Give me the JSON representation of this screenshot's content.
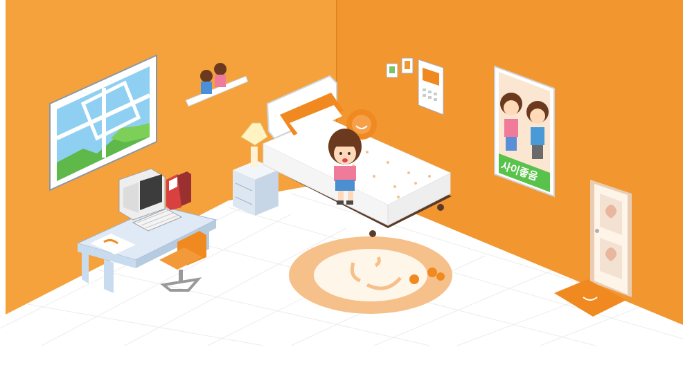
{
  "room": {
    "poster_text": "사이좋음",
    "colors": {
      "left_wall": "#f5a23c",
      "right_wall": "#f29630",
      "floor": "#ffffff",
      "floor_grid": "#ececec",
      "accent_orange": "#f08a20",
      "rug_outer": "#f6c08a",
      "rug_inner": "#fff6ea",
      "desk": "#c9dcef",
      "bed_sheet": "#ffffff",
      "bed_frame": "#5a3a28",
      "door": "#fff4e8",
      "poster_green": "#59c24a"
    },
    "items": [
      "window",
      "wall-shelf",
      "calendar",
      "photo-frames",
      "poster",
      "door",
      "doormat",
      "desk",
      "computer",
      "keyboard",
      "books",
      "office-chair",
      "nightstand",
      "table-lamp",
      "bed",
      "pillows",
      "smiley-cushion",
      "avatar",
      "round-rug",
      "oranges"
    ]
  }
}
